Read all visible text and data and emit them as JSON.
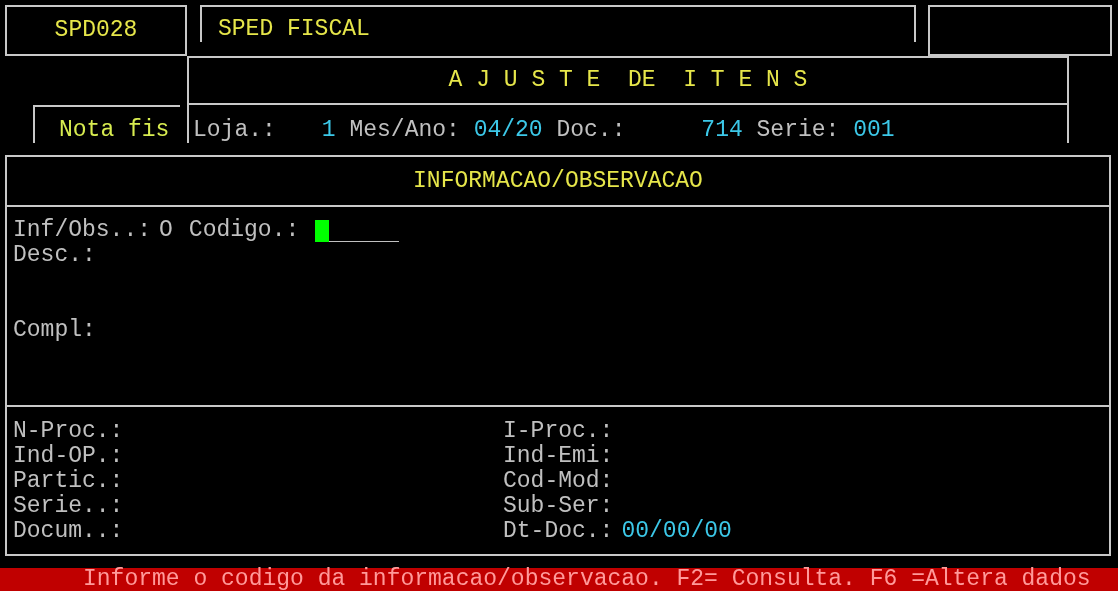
{
  "header": {
    "program_code": "SPD028",
    "system_name": "SPED FISCAL",
    "screen_title": "A J U S T E  DE  I T E N S",
    "section_label": "Nota fis",
    "fields": [
      {
        "label": "Loja.:",
        "value": "1"
      },
      {
        "label": "Mes/Ano:",
        "value": "04/20"
      },
      {
        "label": "Doc.:",
        "value": "714"
      },
      {
        "label": "Serie:",
        "value": "001"
      }
    ]
  },
  "panel": {
    "title": "INFORMACAO/OBSERVACAO",
    "inf_obs": {
      "label": "Inf/Obs..:",
      "value": "O"
    },
    "codigo": {
      "label": "Codigo.:"
    },
    "desc": {
      "label": "Desc.:"
    },
    "compl": {
      "label": "Compl:"
    },
    "details_left": [
      {
        "label": "N-Proc.:"
      },
      {
        "label": "Ind-OP.:"
      },
      {
        "label": "Partic.:"
      },
      {
        "label": "Serie..:"
      },
      {
        "label": "Docum..:"
      }
    ],
    "details_right": [
      {
        "label": "I-Proc.:"
      },
      {
        "label": "Ind-Emi:"
      },
      {
        "label": "Cod-Mod:"
      },
      {
        "label": "Sub-Ser:"
      },
      {
        "label": "Dt-Doc.:",
        "value": "00/00/00"
      }
    ]
  },
  "status_bar": "Informe o codigo da informacao/observacao. F2= Consulta. F6 =Altera dados"
}
